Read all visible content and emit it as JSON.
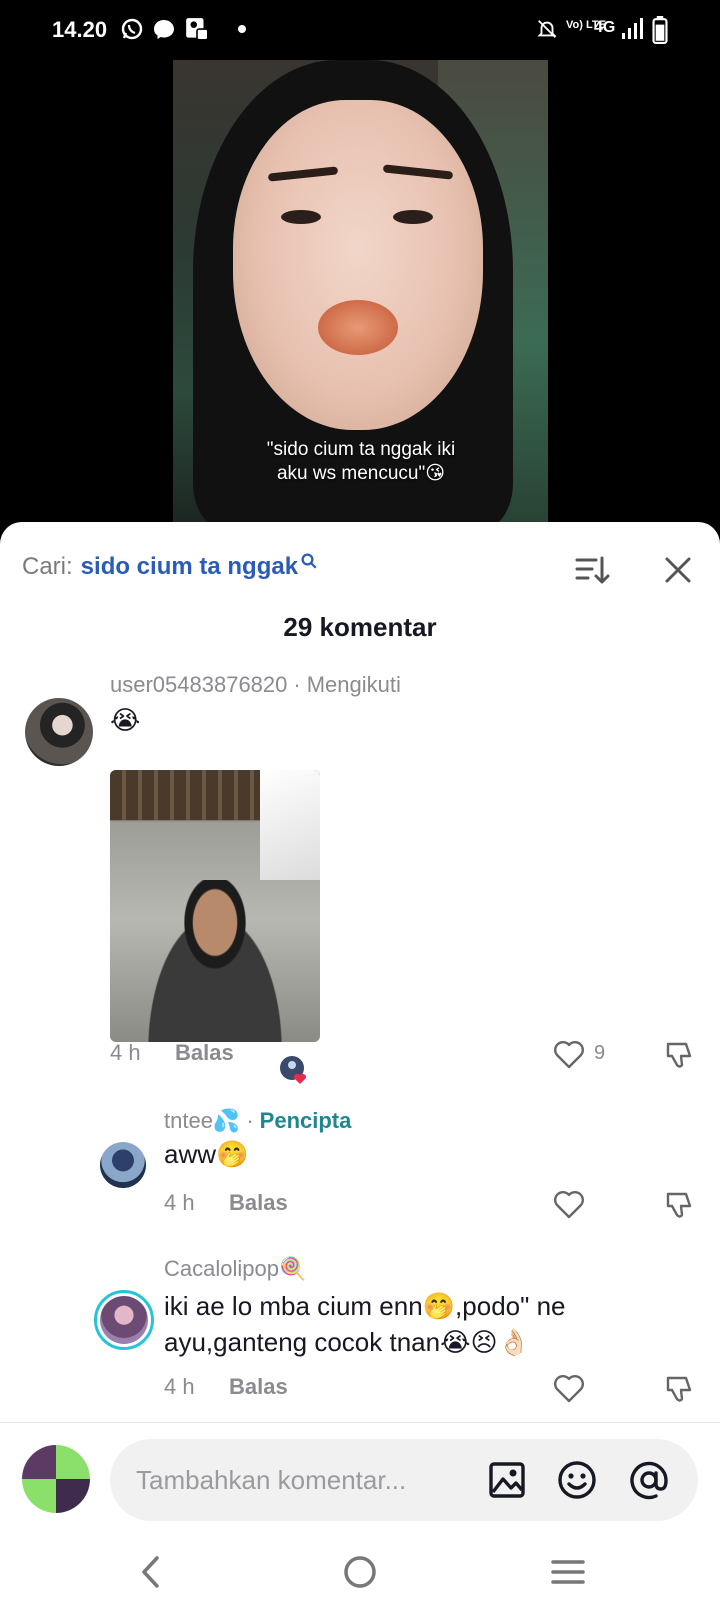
{
  "status_bar": {
    "time": "14.20",
    "network": "4G",
    "volte": "Vo) LTE"
  },
  "video": {
    "caption_line1": "\"sido cium ta nggak iki",
    "caption_line2": "aku ws mencucu\"😘"
  },
  "header": {
    "search_label": "Cari:",
    "search_query": "sido cium ta nggak",
    "comment_count": "29 komentar"
  },
  "comments": [
    {
      "username": "user05483876820",
      "relation": "Mengikuti",
      "text": "😭",
      "time": "4 h",
      "reply_label": "Balas",
      "likes": "9"
    },
    {
      "username": "tntee💦",
      "tag": "Pencipta",
      "text": "aww🤭",
      "time": "4 h",
      "reply_label": "Balas"
    },
    {
      "username": "Cacalolipop🍭",
      "text_line1": "iki ae lo mba cium enn🤭,podo\" ne",
      "text_line2": "ayu,ganteng cocok tnan😭😣👌🏻",
      "time": "4 h",
      "reply_label": "Balas"
    }
  ],
  "input": {
    "placeholder": "Tambahkan komentar..."
  },
  "colors": {
    "query_blue": "#2b5bb6",
    "creator_teal": "#20868f",
    "ring_cyan": "#25c4d8"
  }
}
